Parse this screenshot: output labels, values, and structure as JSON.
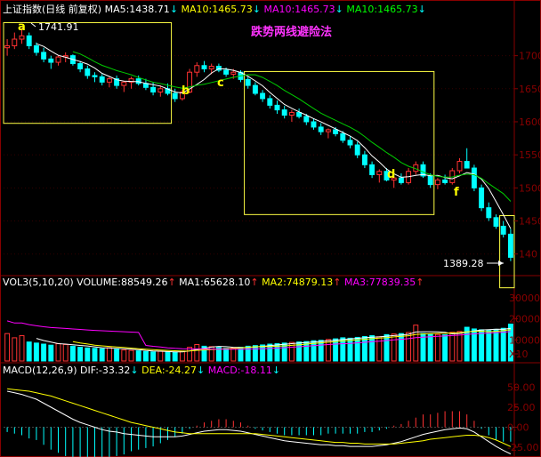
{
  "top_legend": [
    {
      "text": "上证指数(日线 前复权)",
      "color": "#ffffff"
    },
    {
      "text": "MA5:1438.71",
      "color": "#ffffff",
      "arrow": "↓"
    },
    {
      "text": "MA10:1465.73",
      "color": "#ffff00",
      "arrow": "↓"
    },
    {
      "text": "MA10:1465.73",
      "color": "#ff00ff",
      "arrow": "↓"
    },
    {
      "text": "MA10:1465.73",
      "color": "#00ff00",
      "arrow": "↓"
    }
  ],
  "headline": "跌势两线避险法",
  "price_axis_ticks": [
    "1700",
    "1650",
    "1600",
    "1550",
    "1500",
    "1450",
    "140"
  ],
  "annotations": {
    "high_label": "1741.91",
    "low_label": "1389.28",
    "points": [
      "a",
      "b",
      "c",
      "d",
      "f"
    ]
  },
  "vol_legend": [
    {
      "text": "VOL3(5,10,20)",
      "color": "#ffffff"
    },
    {
      "text": "VOLUME:88549.26",
      "color": "#ffffff",
      "arrow": "↑"
    },
    {
      "text": "MA1:65628.10",
      "color": "#ffffff",
      "arrow": "↑"
    },
    {
      "text": "MA2:74879.13",
      "color": "#ffff00",
      "arrow": "↑"
    },
    {
      "text": "MA3:77839.35",
      "color": "#ff00ff",
      "arrow": "↑"
    }
  ],
  "vol_axis_ticks": [
    "30000",
    "20000",
    "10000",
    "X10"
  ],
  "macd_legend": [
    {
      "text": "MACD(12,26,9)",
      "color": "#ffffff"
    },
    {
      "text": "DIF:-33.32",
      "color": "#ffffff",
      "arrow": "↓"
    },
    {
      "text": "DEA:-24.27",
      "color": "#ffff00",
      "arrow": "↓"
    },
    {
      "text": "MACD:-18.11",
      "color": "#ff00ff",
      "arrow": "↓"
    }
  ],
  "macd_axis_ticks": [
    "50.00",
    "25.00",
    "0.00",
    "-25.00"
  ],
  "colors": {
    "up": "#ff3232",
    "down": "#00ffff",
    "ma_white": "#ffffff",
    "ma_yellow": "#ffff00",
    "ma_green": "#00cc00",
    "ma_magenta": "#ff00ff",
    "box": "#ffff44",
    "grid": "#880000",
    "headline": "#ff33ff"
  },
  "chart_data": {
    "type": "candlestick",
    "price_ylim": [
      1370,
      1760
    ],
    "high": 1741.91,
    "low": 1389.28,
    "ohlc": [
      [
        1712,
        1725,
        1700,
        1715
      ],
      [
        1715,
        1735,
        1710,
        1725
      ],
      [
        1725,
        1741.91,
        1718,
        1730
      ],
      [
        1730,
        1735,
        1710,
        1715
      ],
      [
        1715,
        1720,
        1700,
        1705
      ],
      [
        1705,
        1712,
        1690,
        1695
      ],
      [
        1695,
        1700,
        1680,
        1690
      ],
      [
        1690,
        1700,
        1685,
        1698
      ],
      [
        1698,
        1705,
        1690,
        1700
      ],
      [
        1700,
        1702,
        1685,
        1688
      ],
      [
        1688,
        1692,
        1675,
        1680
      ],
      [
        1680,
        1685,
        1665,
        1670
      ],
      [
        1670,
        1675,
        1660,
        1668
      ],
      [
        1668,
        1672,
        1655,
        1660
      ],
      [
        1660,
        1668,
        1652,
        1665
      ],
      [
        1665,
        1670,
        1650,
        1655
      ],
      [
        1655,
        1662,
        1645,
        1660
      ],
      [
        1660,
        1668,
        1650,
        1665
      ],
      [
        1665,
        1670,
        1655,
        1658
      ],
      [
        1658,
        1665,
        1648,
        1652
      ],
      [
        1652,
        1660,
        1640,
        1645
      ],
      [
        1645,
        1655,
        1638,
        1650
      ],
      [
        1650,
        1658,
        1640,
        1643
      ],
      [
        1643,
        1650,
        1630,
        1635
      ],
      [
        1635,
        1648,
        1632,
        1645
      ],
      [
        1645,
        1680,
        1643,
        1675
      ],
      [
        1675,
        1690,
        1668,
        1685
      ],
      [
        1685,
        1692,
        1675,
        1680
      ],
      [
        1680,
        1688,
        1672,
        1684
      ],
      [
        1684,
        1688,
        1675,
        1678
      ],
      [
        1678,
        1682,
        1668,
        1672
      ],
      [
        1672,
        1680,
        1665,
        1675
      ],
      [
        1675,
        1678,
        1660,
        1664
      ],
      [
        1664,
        1668,
        1650,
        1655
      ],
      [
        1655,
        1660,
        1640,
        1643
      ],
      [
        1643,
        1648,
        1630,
        1635
      ],
      [
        1635,
        1640,
        1620,
        1625
      ],
      [
        1625,
        1632,
        1612,
        1618
      ],
      [
        1618,
        1624,
        1605,
        1610
      ],
      [
        1610,
        1618,
        1600,
        1614
      ],
      [
        1614,
        1620,
        1605,
        1608
      ],
      [
        1608,
        1612,
        1595,
        1600
      ],
      [
        1600,
        1605,
        1588,
        1592
      ],
      [
        1592,
        1598,
        1580,
        1585
      ],
      [
        1585,
        1590,
        1575,
        1588
      ],
      [
        1588,
        1592,
        1578,
        1582
      ],
      [
        1582,
        1586,
        1568,
        1572
      ],
      [
        1572,
        1578,
        1560,
        1565
      ],
      [
        1565,
        1570,
        1545,
        1550
      ],
      [
        1550,
        1556,
        1530,
        1535
      ],
      [
        1535,
        1540,
        1515,
        1520
      ],
      [
        1520,
        1528,
        1508,
        1525
      ],
      [
        1525,
        1530,
        1510,
        1512
      ],
      [
        1512,
        1518,
        1500,
        1515
      ],
      [
        1515,
        1522,
        1505,
        1508
      ],
      [
        1508,
        1530,
        1505,
        1525
      ],
      [
        1525,
        1540,
        1520,
        1535
      ],
      [
        1535,
        1540,
        1515,
        1518
      ],
      [
        1518,
        1522,
        1500,
        1505
      ],
      [
        1505,
        1515,
        1498,
        1512
      ],
      [
        1512,
        1520,
        1505,
        1508
      ],
      [
        1508,
        1530,
        1505,
        1526
      ],
      [
        1526,
        1545,
        1522,
        1540
      ],
      [
        1540,
        1560,
        1535,
        1530
      ],
      [
        1530,
        1535,
        1495,
        1500
      ],
      [
        1500,
        1505,
        1465,
        1470
      ],
      [
        1470,
        1478,
        1450,
        1455
      ],
      [
        1455,
        1460,
        1438,
        1442
      ],
      [
        1442,
        1450,
        1425,
        1430
      ],
      [
        1430,
        1438,
        1389.28,
        1395
      ]
    ],
    "volume_ylim": [
      0,
      35000
    ],
    "volume": [
      13000,
      11000,
      12000,
      9000,
      8500,
      8000,
      7500,
      8200,
      7800,
      7000,
      6500,
      6200,
      6000,
      5800,
      6300,
      5500,
      5200,
      5000,
      4800,
      4500,
      4300,
      4600,
      4200,
      4000,
      4700,
      6500,
      7800,
      7000,
      6800,
      6400,
      6000,
      6200,
      6500,
      7000,
      7300,
      7600,
      8000,
      8200,
      8500,
      8800,
      9000,
      9200,
      9600,
      9800,
      10200,
      10500,
      11000,
      10800,
      11200,
      11600,
      12000,
      11500,
      12500,
      12800,
      13000,
      13500,
      17000,
      13000,
      12800,
      12600,
      12400,
      13600,
      14000,
      16000,
      15200,
      14800,
      14500,
      15000,
      15500,
      17500
    ],
    "macd_ylim": [
      -35,
      65
    ],
    "dif": [
      45,
      43,
      41,
      38,
      35,
      30,
      25,
      20,
      15,
      10,
      6,
      3,
      0,
      -3,
      -5,
      -6,
      -8,
      -9,
      -10,
      -11,
      -12,
      -12,
      -12,
      -12,
      -11,
      -9,
      -7,
      -5,
      -4,
      -3,
      -3,
      -4,
      -5,
      -7,
      -9,
      -11,
      -13,
      -15,
      -17,
      -18,
      -19,
      -20,
      -21,
      -22,
      -22,
      -23,
      -23,
      -24,
      -24,
      -24,
      -24,
      -23,
      -22,
      -20,
      -18,
      -15,
      -12,
      -9,
      -7,
      -5,
      -3,
      -2,
      -1,
      -2,
      -6,
      -12,
      -18,
      -24,
      -29,
      -33.32
    ],
    "dea": [
      48,
      47,
      46,
      45,
      43,
      41,
      39,
      36,
      33,
      30,
      27,
      24,
      21,
      18,
      15,
      12,
      9,
      6,
      4,
      2,
      0,
      -2,
      -4,
      -6,
      -7,
      -8,
      -8,
      -8,
      -8,
      -8,
      -8,
      -8,
      -8,
      -8,
      -8,
      -9,
      -10,
      -11,
      -12,
      -13,
      -14,
      -15,
      -16,
      -17,
      -18,
      -19,
      -19,
      -20,
      -20,
      -21,
      -21,
      -21,
      -21,
      -21,
      -20,
      -19,
      -18,
      -17,
      -15,
      -14,
      -13,
      -12,
      -11,
      -10,
      -10,
      -11,
      -13,
      -16,
      -20,
      -24.27
    ]
  }
}
